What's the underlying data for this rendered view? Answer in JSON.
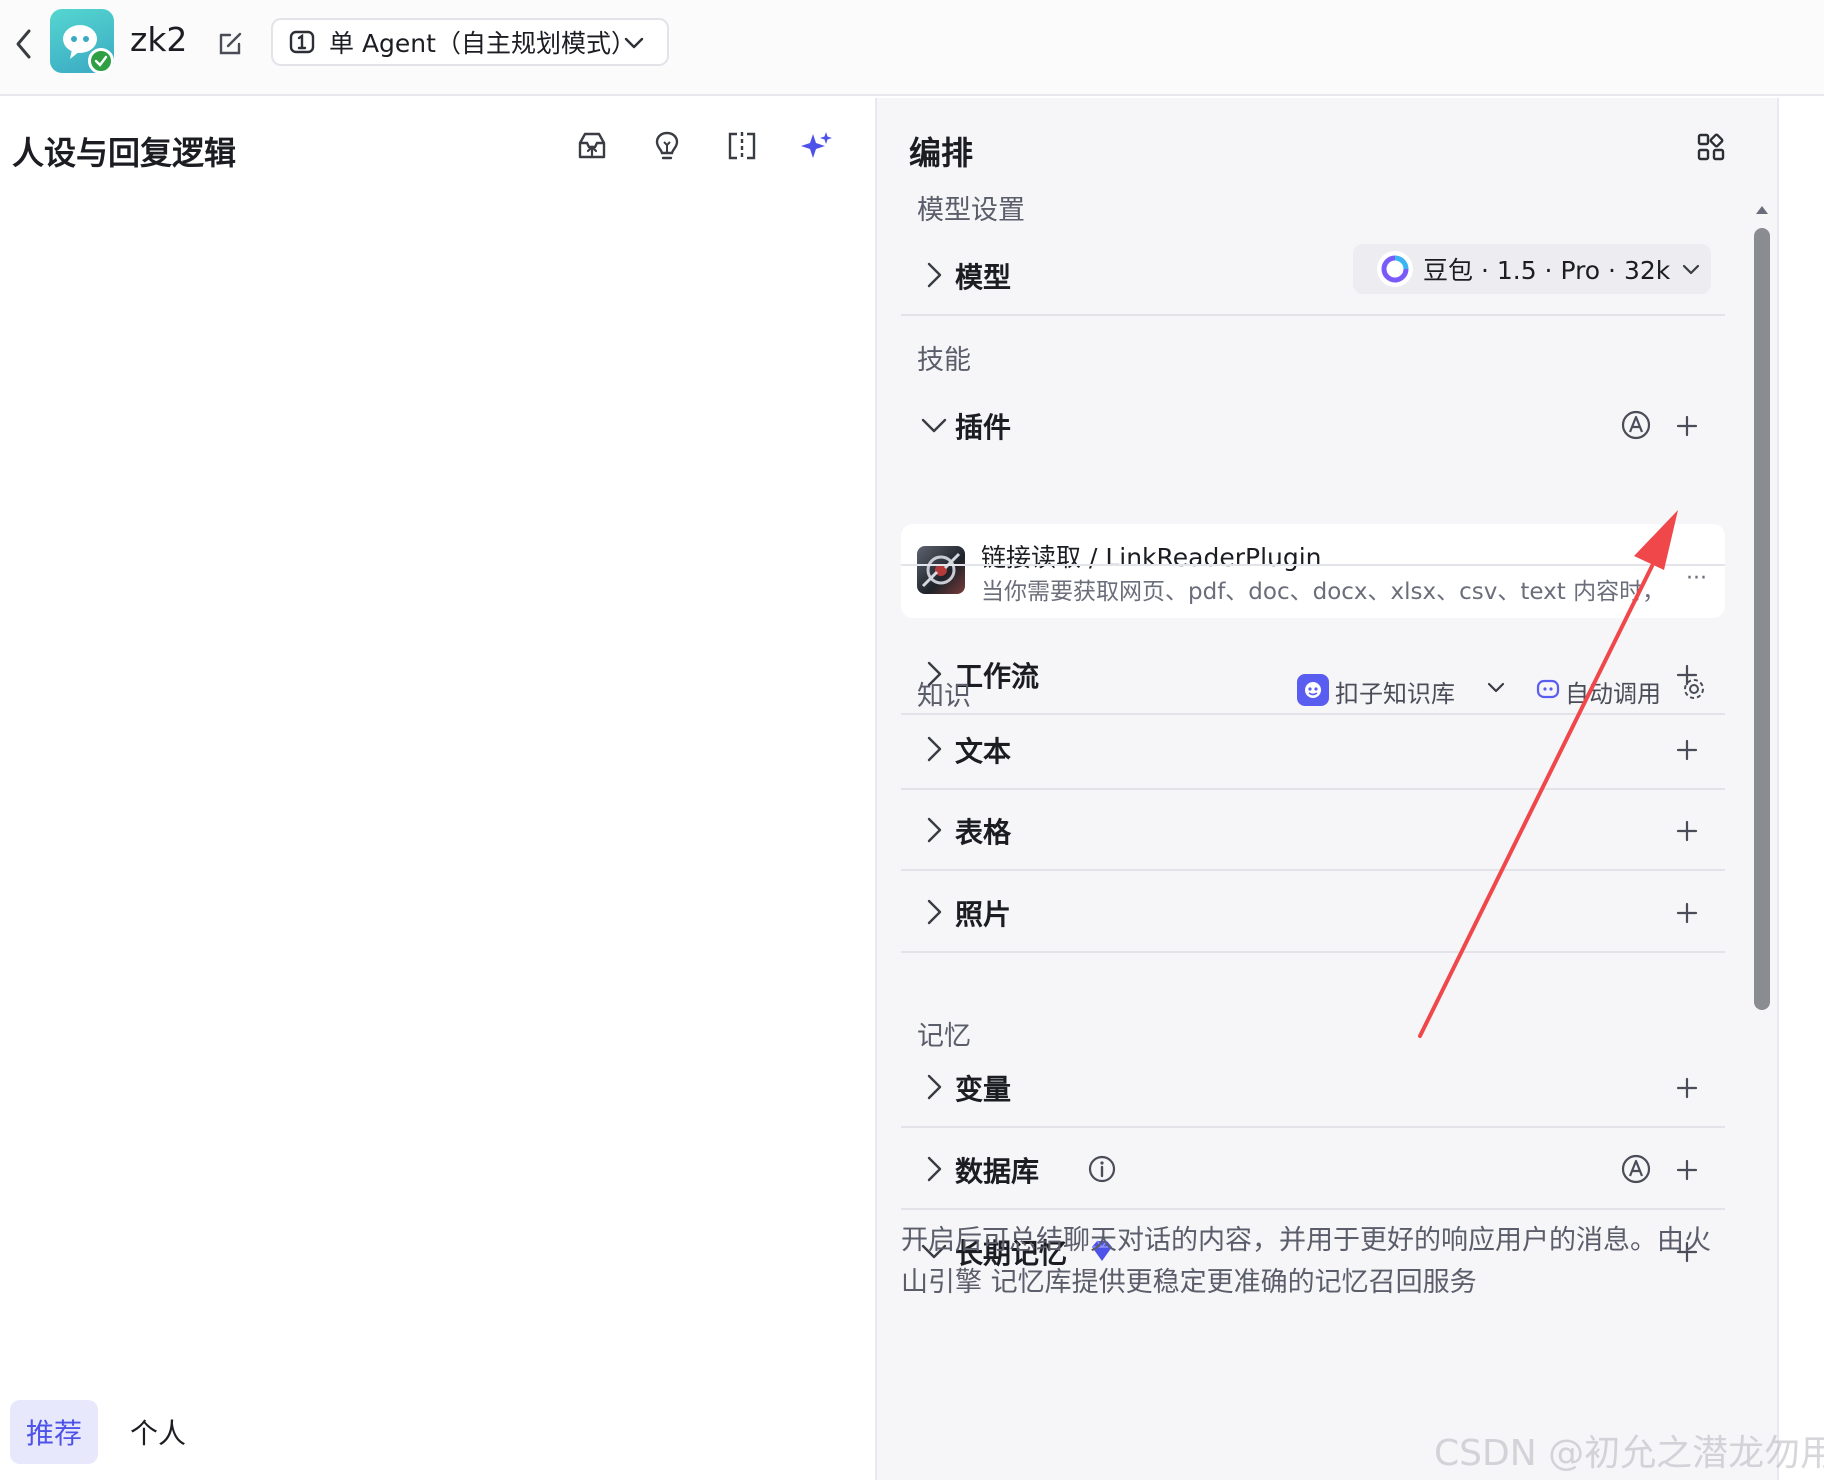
{
  "header": {
    "bot_name": "zk2",
    "mode_label": "单 Agent（自主规划模式）"
  },
  "left": {
    "title": "人设与回复逻辑",
    "tabs": [
      {
        "label": "推荐",
        "active": true
      },
      {
        "label": "个人",
        "active": false
      }
    ]
  },
  "right": {
    "title": "编排",
    "model_section": "模型设置",
    "model_row_label": "模型",
    "model_value": "豆包 · 1.5 · Pro · 32k",
    "skills_section": "技能",
    "plugin_row_label": "插件",
    "plugin": {
      "name": "链接读取 / LinkReaderPlugin",
      "description": "当你需要获取网页、pdf、doc、docx、xlsx、csv、text 内容时，",
      "more": "···"
    },
    "workflow_row_label": "工作流",
    "knowledge_section": "知识",
    "knowledge_base": "扣子知识库",
    "auto_call": "自动调用",
    "text_row_label": "文本",
    "table_row_label": "表格",
    "photo_row_label": "照片",
    "memory_section": "记忆",
    "variable_row_label": "变量",
    "database_row_label": "数据库",
    "ltm_row_label": "长期记忆",
    "ltm_description": "开启后可总结聊天对话的内容，并用于更好的响应用户的消息。由火山引擎 记忆库提供更稳定更准确的记忆召回服务"
  },
  "watermark": "CSDN @初允之潜龙勿用",
  "colors": {
    "accent": "#4d53e8",
    "arrow": "#f0474b",
    "panel_bg": "#f6f6f9",
    "success": "#2ea043"
  },
  "icons": {
    "back": "chevron-left-icon",
    "edit": "edit-icon",
    "mode": "agent-mode-icon",
    "publish": "publish-icon",
    "hint": "bulb-icon",
    "compare": "split-view-icon",
    "optimize": "sparkle-icon",
    "layout": "grid-icon",
    "auto_mode": "auto-a-icon",
    "add": "plus-icon",
    "info": "info-icon",
    "premium": "diamond-icon",
    "settings": "gear-icon"
  }
}
